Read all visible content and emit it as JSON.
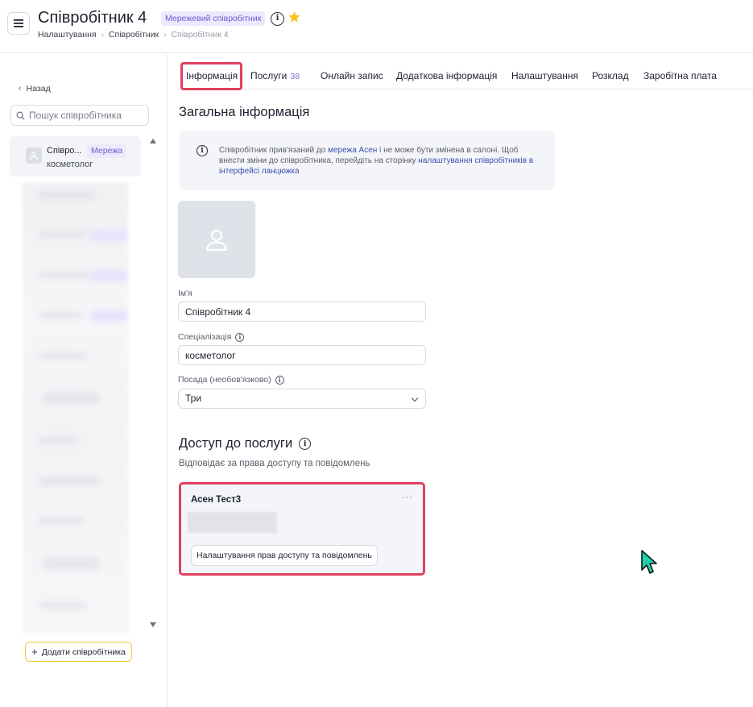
{
  "header": {
    "title": "Співробітник 4",
    "badge": "Мережевий співробітник",
    "breadcrumb": [
      "Налаштування",
      "Співробітник",
      "Співробітник 4"
    ]
  },
  "sidebar": {
    "back_label": "Назад",
    "search_placeholder": "Пошук співробітника",
    "selected_employee": {
      "name": "Співро...",
      "badge": "Мережа",
      "role": "косметолог"
    },
    "add_button": "Додати співробітника"
  },
  "tabs": [
    {
      "label": "Інформація"
    },
    {
      "label": "Послуги",
      "count": "38"
    },
    {
      "label": "Онлайн запис"
    },
    {
      "label": "Додаткова інформація"
    },
    {
      "label": "Налаштування"
    },
    {
      "label": "Розклад"
    },
    {
      "label": "Заробітна плата"
    }
  ],
  "general": {
    "title": "Загальна інформація",
    "notice": {
      "pre": "Співробітник прив'язаний до ",
      "link1": "мережа Асен",
      "mid": " і не може бути змінена в салоні. Щоб внести зміни до співробітника, перейдіть на сторінку ",
      "link2": "налаштування співробітників в інтерфейсі ланцюжка"
    },
    "name_label": "Ім'я",
    "name_value": "Співробітник 4",
    "spec_label": "Спеціалізація",
    "spec_value": "косметолог",
    "position_label": "Посада (необов'язково)",
    "position_value": "Три"
  },
  "access": {
    "title": "Доступ до послуги",
    "subtitle": "Відповідає за права доступу та повідомлень",
    "card_name": "Асен Тест3",
    "card_button": "Налаштування прав доступу та повідомлень"
  },
  "colors": {
    "accent_red": "#e0405e",
    "badge_bg": "#ece9fc",
    "badge_text": "#6b5ccf",
    "add_button_border": "#efc93e",
    "cursor": "#1fd1a6"
  }
}
